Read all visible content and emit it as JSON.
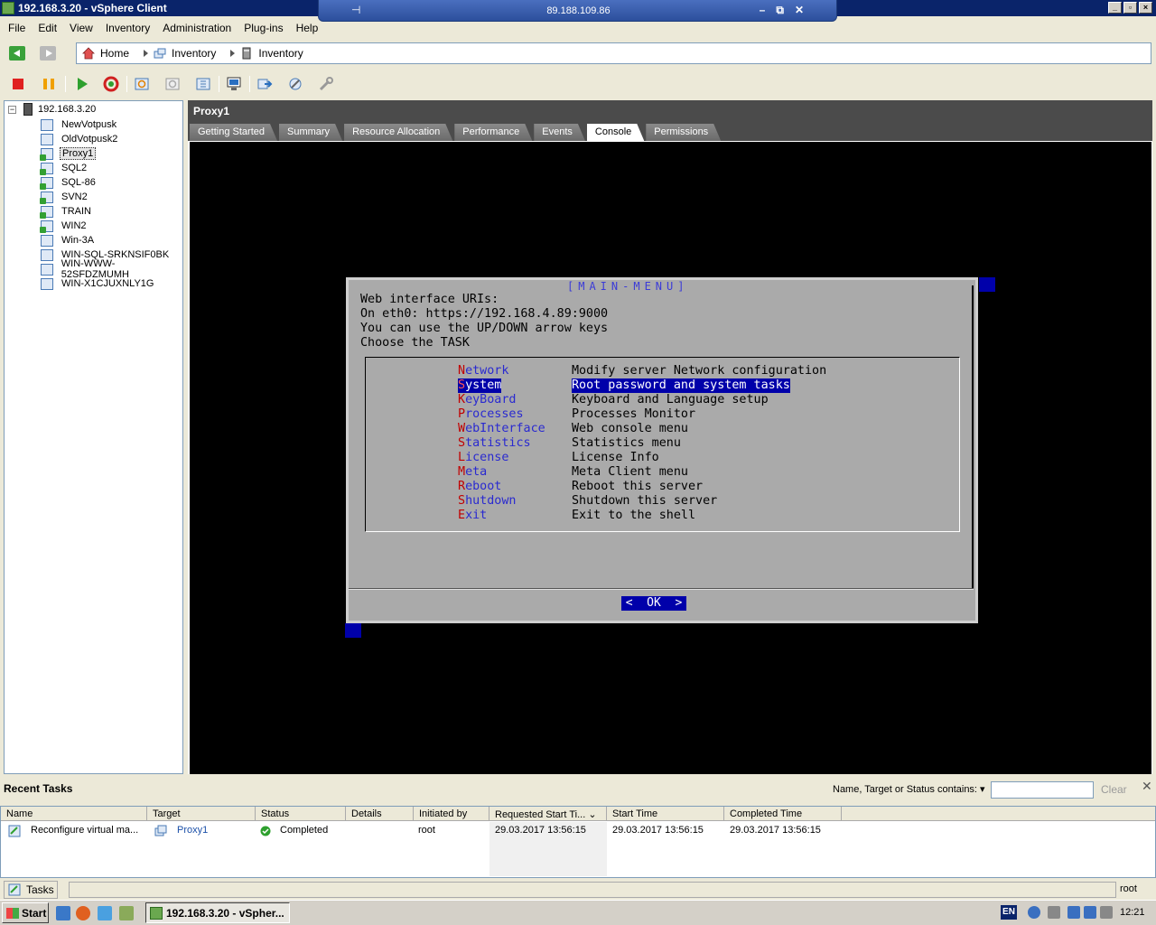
{
  "window": {
    "title": "192.168.3.20 - vSphere Client"
  },
  "rdp": {
    "address": "89.188.109.86"
  },
  "menu": [
    "File",
    "Edit",
    "View",
    "Inventory",
    "Administration",
    "Plug-ins",
    "Help"
  ],
  "breadcrumb": [
    "Home",
    "Inventory",
    "Inventory"
  ],
  "tree": {
    "root": "192.168.3.20",
    "items": [
      {
        "label": "NewVotpusk",
        "on": false
      },
      {
        "label": "OldVotpusk2",
        "on": false
      },
      {
        "label": "Proxy1",
        "on": true,
        "selected": true
      },
      {
        "label": "SQL2",
        "on": true
      },
      {
        "label": "SQL-86",
        "on": true
      },
      {
        "label": "SVN2",
        "on": true
      },
      {
        "label": "TRAIN",
        "on": true
      },
      {
        "label": "WIN2",
        "on": true
      },
      {
        "label": "Win-3A",
        "on": false
      },
      {
        "label": "WIN-SQL-SRKNSIF0BK",
        "on": false
      },
      {
        "label": "WIN-WWW-52SFDZMUMH",
        "on": false
      },
      {
        "label": "WIN-X1CJUXNLY1G",
        "on": false
      }
    ]
  },
  "vm": {
    "name": "Proxy1",
    "tabs": [
      "Getting Started",
      "Summary",
      "Resource Allocation",
      "Performance",
      "Events",
      "Console",
      "Permissions"
    ],
    "active_tab": "Console"
  },
  "console": {
    "dialog_title": "[MAIN-MENU]",
    "intro": [
      "Web interface URIs:",
      "On eth0: https://192.168.4.89:9000",
      "You can use the UP/DOWN arrow keys",
      "Choose the TASK"
    ],
    "menu_items": [
      {
        "hot": "N",
        "rest": "etwork",
        "desc": "Modify server Network configuration"
      },
      {
        "hot": "S",
        "rest": "ystem",
        "desc": "Root password and system tasks",
        "selected": true
      },
      {
        "hot": "K",
        "rest": "eyBoard",
        "desc": "Keyboard and Language setup"
      },
      {
        "hot": "P",
        "rest": "rocesses",
        "desc": "Processes Monitor"
      },
      {
        "hot": "W",
        "rest": "ebInterface",
        "desc": "Web console menu"
      },
      {
        "hot": "S",
        "rest": "tatistics",
        "desc": "Statistics menu"
      },
      {
        "hot": "L",
        "rest": "icense",
        "desc": "License Info"
      },
      {
        "hot": "M",
        "rest": "eta",
        "desc": "Meta Client menu"
      },
      {
        "hot": "R",
        "rest": "eboot",
        "desc": "Reboot this server"
      },
      {
        "hot": "S",
        "rest": "hutdown",
        "desc": "Shutdown this server"
      },
      {
        "hot": "E",
        "rest": "xit",
        "desc": "Exit to the shell"
      }
    ],
    "ok_label": "<  OK  >"
  },
  "recent_tasks": {
    "title": "Recent Tasks",
    "filter_label": "Name, Target or Status contains: ▾",
    "filter_value": "",
    "clear_label": "Clear",
    "columns": [
      "Name",
      "Target",
      "Status",
      "Details",
      "Initiated by",
      "Requested Start Ti...",
      "Start Time",
      "Completed Time"
    ],
    "rows": [
      {
        "name": "Reconfigure virtual ma...",
        "target": "Proxy1",
        "status": "Completed",
        "details": "",
        "initiated_by": "root",
        "requested_start": "29.03.2017 13:56:15",
        "start_time": "29.03.2017 13:56:15",
        "completed_time": "29.03.2017 13:56:15"
      }
    ]
  },
  "statusbar": {
    "tasks_label": "Tasks",
    "user": "root"
  },
  "taskbar": {
    "start_label": "Start",
    "app_label": "192.168.3.20 - vSpher...",
    "lang": "EN",
    "clock": "12:21"
  }
}
